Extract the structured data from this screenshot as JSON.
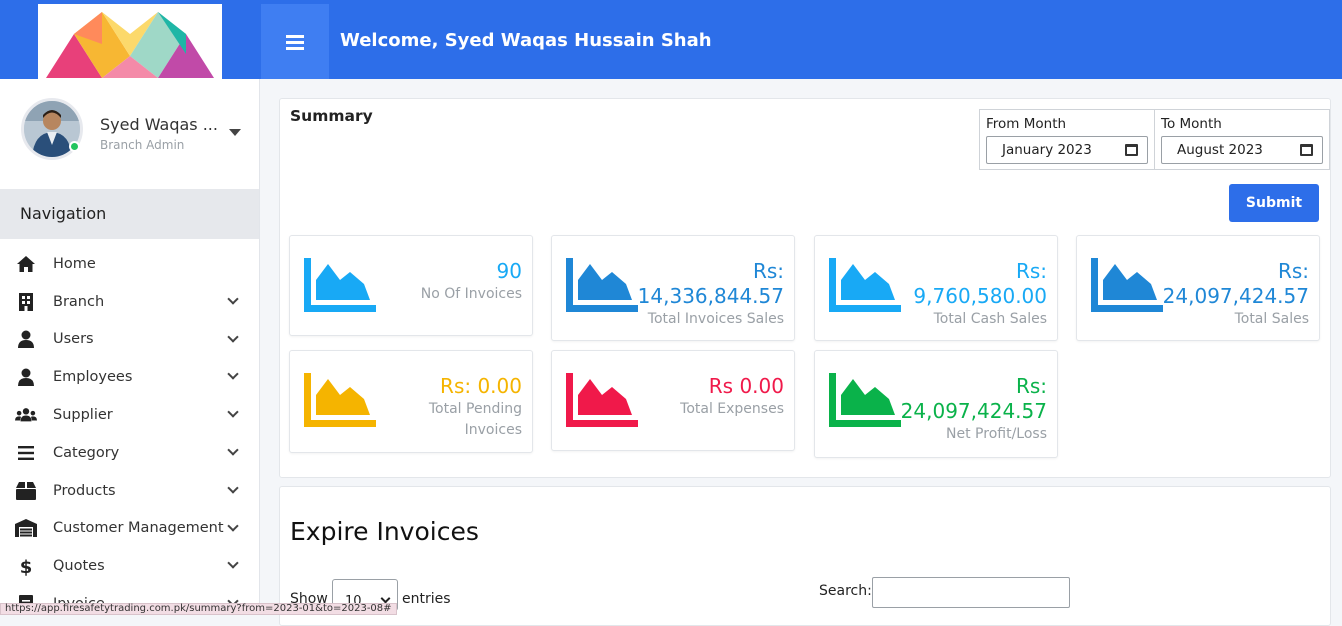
{
  "header": {
    "welcome_text": "Welcome, Syed Waqas Hussain Shah",
    "logo_icon": "logo-icon",
    "menu_icon": "hamburger-icon",
    "accent_color": "#2d6ee9"
  },
  "sidebar": {
    "user_name": "Syed Waqas ...",
    "user_role": "Branch Admin",
    "nav_header": "Navigation",
    "items": [
      {
        "label": "Home",
        "icon": "home-icon"
      },
      {
        "label": "Branch",
        "icon": "building-icon"
      },
      {
        "label": "Users",
        "icon": "user-icon"
      },
      {
        "label": "Employees",
        "icon": "user-icon"
      },
      {
        "label": "Supplier",
        "icon": "users-icon"
      },
      {
        "label": "Category",
        "icon": "list-icon"
      },
      {
        "label": "Products",
        "icon": "box-icon"
      },
      {
        "label": "Customer Management",
        "icon": "warehouse-icon"
      },
      {
        "label": "Quotes",
        "icon": "dollar-icon"
      },
      {
        "label": "Invoice",
        "icon": "file-icon"
      }
    ]
  },
  "summary": {
    "title": "Summary",
    "from_label": "From Month",
    "from_value": "January 2023",
    "to_label": "To Month",
    "to_value": "August 2023",
    "submit_label": "Submit",
    "stats": [
      {
        "value": "90",
        "label": "No Of Invoices",
        "color": "#18a9f5"
      },
      {
        "value_prefix": "Rs:",
        "value": "14,336,844.57",
        "label": "Total Invoices Sales",
        "color": "#1f87d6"
      },
      {
        "value_prefix": "Rs:",
        "value": "9,760,580.00",
        "label": "Total Cash Sales",
        "color": "#18a9f5"
      },
      {
        "value_prefix": "Rs:",
        "value": "24,097,424.57",
        "label": "Total Sales",
        "color": "#1f87d6"
      },
      {
        "value": "Rs: 0.00",
        "label_line1": "Total Pending",
        "label_line2": "Invoices",
        "color": "#f5b400"
      },
      {
        "value": "Rs 0.00",
        "label": "Total Expenses",
        "color": "#f0194a"
      },
      {
        "value_prefix": "Rs:",
        "value": "24,097,424.57",
        "label": "Net Profit/Loss",
        "color": "#0ab24a"
      }
    ]
  },
  "expire": {
    "title": "Expire Invoices",
    "show_label": "Show",
    "entries_value": "10",
    "entries_label": "entries",
    "search_label": "Search:"
  },
  "status_url": "https://app.firesafetytrading.com.pk/summary?from=2023-01&to=2023-08#"
}
